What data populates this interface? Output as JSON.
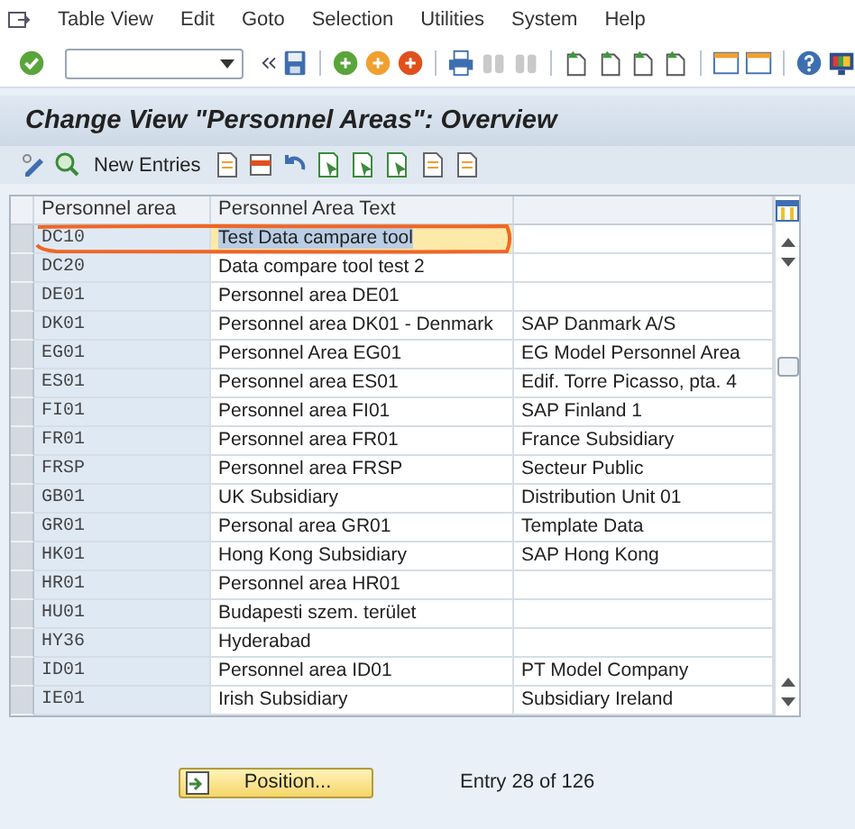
{
  "menu": [
    {
      "label": "Table View"
    },
    {
      "label": "Edit"
    },
    {
      "label": "Goto"
    },
    {
      "label": "Selection"
    },
    {
      "label": "Utilities"
    },
    {
      "label": "System"
    },
    {
      "label": "Help"
    }
  ],
  "title": "Change View \"Personnel Areas\": Overview",
  "app_toolbar": {
    "new_entries": "New Entries"
  },
  "table": {
    "columns": [
      "Personnel area",
      "Personnel Area Text"
    ],
    "rows": [
      {
        "area": "DC10",
        "text": "Test Data campare tool",
        "selected": true
      },
      {
        "area": "DC20",
        "text": "Data compare tool test 2",
        "selected": false
      },
      {
        "area": "DE01",
        "text": "Personnel area DE01",
        "selected": false
      },
      {
        "area": "DK01",
        "text": "Personnel area DK01 - Denmark",
        "column_3": "SAP Danmark A/S",
        "selected": false
      },
      {
        "area": "EG01",
        "text": "Personnel Area EG01",
        "column_3": "EG Model Personnel Area",
        "selected": false
      },
      {
        "area": "ES01",
        "text": "Personnel area ES01",
        "column_3": "Edif. Torre Picasso, pta. 4",
        "selected": false
      },
      {
        "area": "FI01",
        "text": "Personnel area FI01",
        "column_3": "SAP Finland 1",
        "selected": false
      },
      {
        "area": "FR01",
        "text": "Personnel area FR01",
        "column_3": "France Subsidiary",
        "selected": false
      },
      {
        "area": "FRSP",
        "text": "Personnel area FRSP",
        "column_3": "Secteur Public",
        "selected": false
      },
      {
        "area": "GB01",
        "text": "UK Subsidiary",
        "column_3": "Distribution Unit 01",
        "selected": false
      },
      {
        "area": "GR01",
        "text": "Personal area GR01",
        "column_3": "Template Data",
        "selected": false
      },
      {
        "area": "HK01",
        "text": "Hong Kong Subsidiary",
        "column_3": "SAP Hong Kong",
        "selected": false
      },
      {
        "area": "HR01",
        "text": "Personnel area HR01",
        "selected": false
      },
      {
        "area": "HU01",
        "text": "Budapesti szem. terület",
        "selected": false
      },
      {
        "area": "HY36",
        "text": "Hyderabad",
        "selected": false
      },
      {
        "area": "ID01",
        "text": "Personnel area ID01",
        "column_3": "PT Model Company",
        "selected": false
      },
      {
        "area": "IE01",
        "text": "Irish Subsidiary",
        "column_3": "Subsidiary Ireland",
        "selected": false
      }
    ]
  },
  "position_button": "Position...",
  "entry_info": "Entry 28 of 126"
}
